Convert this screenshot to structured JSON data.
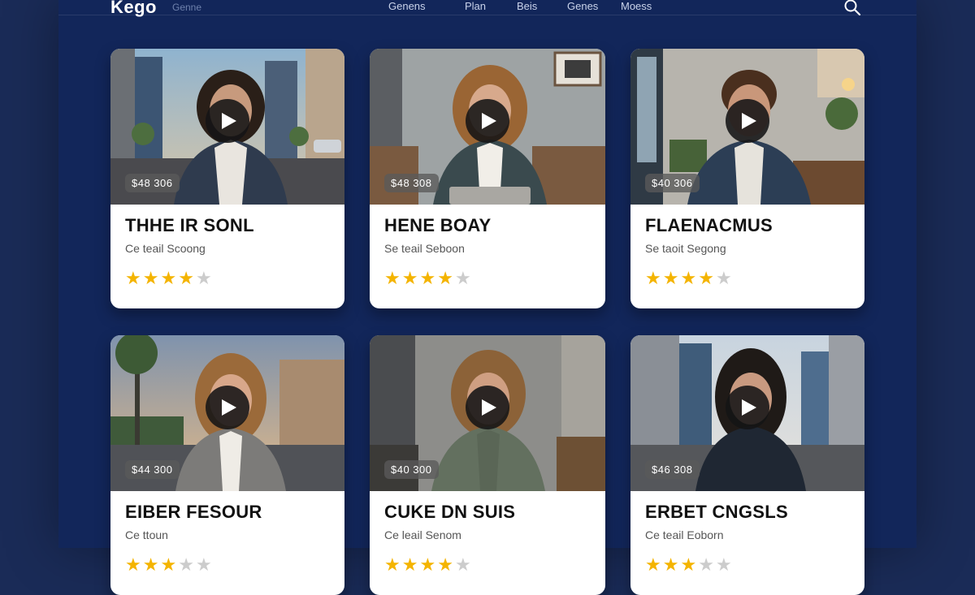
{
  "header": {
    "logo": "Kego",
    "logo_sub": "Genne",
    "nav": [
      "Genens",
      "Plan",
      "Beis",
      "Genes",
      "Moess"
    ]
  },
  "cards": [
    {
      "title": "THHE IR SONL",
      "subtitle": "Ce teail Scoong",
      "price": "$48 306",
      "rating": 4,
      "max_rating": 5
    },
    {
      "title": "HENE BOAY",
      "subtitle": "Se teail Seboon",
      "price": "$48 308",
      "rating": 4,
      "max_rating": 5
    },
    {
      "title": "FLAENACMUS",
      "subtitle": "Se taoit Segong",
      "price": "$40 306",
      "rating": 4,
      "max_rating": 5
    },
    {
      "title": "EIBER FESOUR",
      "subtitle": "Ce ttoun",
      "price": "$44 300",
      "rating": 3,
      "max_rating": 5
    },
    {
      "title": "CUKE DN SUIS",
      "subtitle": "Ce leail Senom",
      "price": "$40 300",
      "rating": 4,
      "max_rating": 5
    },
    {
      "title": "ERBET CNGSLS",
      "subtitle": "Ce teail Eoborn",
      "price": "$46 308",
      "rating": 3,
      "max_rating": 5
    }
  ],
  "icons": {
    "search": "search-icon",
    "play": "play-icon",
    "star": "star-icon"
  },
  "colors": {
    "background": "#12265a",
    "star": "#f4b400",
    "star_empty": "#cccccc"
  }
}
